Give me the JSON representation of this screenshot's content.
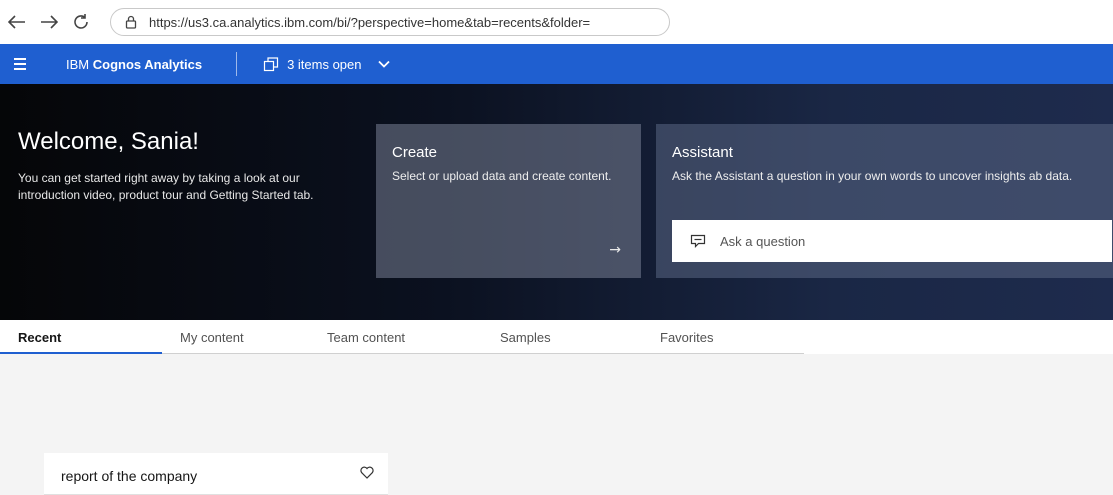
{
  "browser": {
    "back_icon": "arrow-left-icon",
    "forward_icon": "arrow-right-icon",
    "reload_icon": "reload-icon",
    "url": "https://us3.ca.analytics.ibm.com/bi/?perspective=home&tab=recents&folder="
  },
  "header": {
    "brand_prefix": "IBM ",
    "brand_bold": "Cognos Analytics",
    "items_open": "3 items open",
    "accent_color": "#1f5fd0"
  },
  "hero": {
    "welcome_title": "Welcome, Sania!",
    "welcome_body": "You can get started right away by taking a look at our introduction video, product tour and Getting Started tab.",
    "create": {
      "title": "Create",
      "description": "Select or upload data and create content.",
      "arrow": "→"
    },
    "assistant": {
      "title": "Assistant",
      "description": "Ask the Assistant a question in your own words to uncover insights ab data.",
      "ask_placeholder": "Ask a question"
    }
  },
  "tabs": [
    {
      "label": "Recent",
      "active": true
    },
    {
      "label": "My content",
      "active": false
    },
    {
      "label": "Team content",
      "active": false
    },
    {
      "label": "Samples",
      "active": false
    },
    {
      "label": "Favorites",
      "active": false
    }
  ],
  "recent_items": [
    {
      "name": "report of the company",
      "favorite_icon": "heart-icon"
    }
  ]
}
